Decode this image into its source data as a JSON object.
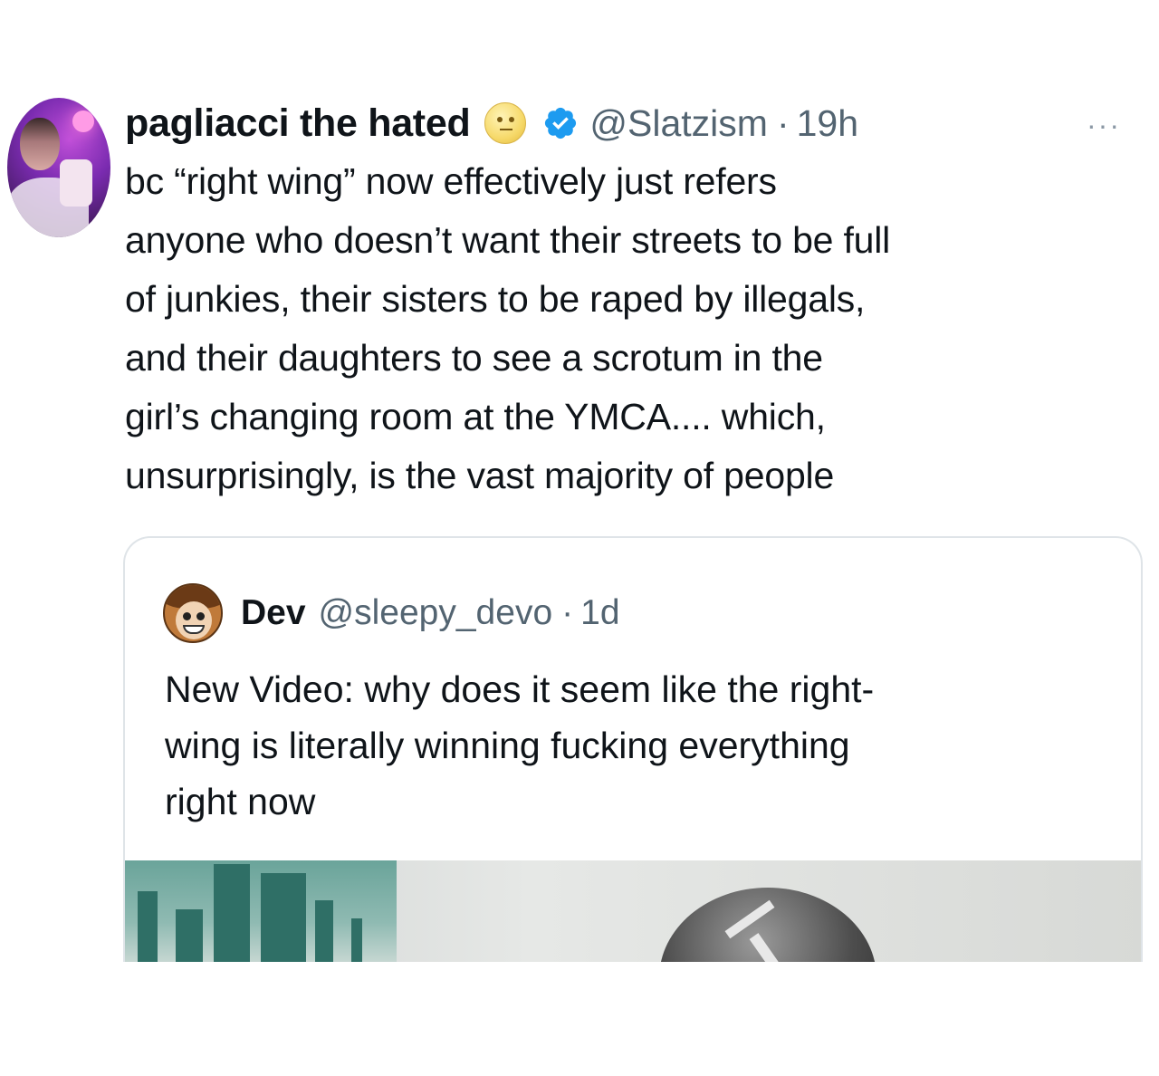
{
  "tweet": {
    "display_name": "pagliacci the hated",
    "handle": "@Slatzism",
    "time": "19h",
    "separator": "·",
    "more_icon": "···",
    "text_lines": [
      "bc “right wing” now effectively just refers",
      "anyone who doesn’t want their streets to be full",
      "of junkies, their sisters to be raped by illegals,",
      "and their daughters to see a scrotum in the",
      "girl’s changing room at the YMCA.... which,",
      "unsurprisingly, is the vast majority of people"
    ]
  },
  "quote": {
    "display_name": "Dev",
    "handle": "@sleepy_devo",
    "time": "1d",
    "separator": "·",
    "text_lines": [
      "New Video: why does it seem like the right-",
      "wing is literally winning fucking everything",
      "right now"
    ]
  },
  "colors": {
    "text": "#0f1419",
    "secondary": "#536471",
    "verified": "#1d9bf0",
    "border": "#dfe4e8"
  }
}
